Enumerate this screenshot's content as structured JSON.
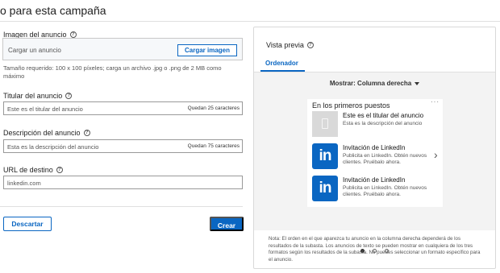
{
  "header": {
    "title": "o para esta campaña"
  },
  "form": {
    "image": {
      "label": "Imagen del anuncio",
      "placeholder": "Cargar un anuncio",
      "upload_button": "Cargar imagen",
      "help": "Tamaño requerido: 100 x 100 píxeles; carga un archivo .jpg o .png de 2 MB como máximo"
    },
    "headline": {
      "label": "Titular del anuncio",
      "placeholder": "Este es el titular del anuncio",
      "counter": "Quedan 25 caracteres"
    },
    "description": {
      "label": "Descripción del anuncio",
      "placeholder": "Esta es la descripción del anuncio",
      "counter": "Quedan 75 caracteres"
    },
    "url": {
      "label": "URL de destino",
      "placeholder": "linkedin.com"
    },
    "cancel_button": "Descartar",
    "create_button": "Crear"
  },
  "preview": {
    "title": "Vista previa",
    "tab": "Ordenador",
    "show_label": "Mostrar: Columna derecha",
    "card_title": "En los primeros puestos",
    "card_menu": "···",
    "ads": [
      {
        "title": "Este es el titular del anuncio",
        "desc": "Esta es la descripción del anuncio",
        "thumb": "placeholder-image-icon"
      },
      {
        "title": "Invitación de LinkedIn",
        "desc": "Publicita en LinkedIn. Obtén nuevos clientes. Pruébalo ahora.",
        "thumb": "linkedin-icon",
        "logo": "in"
      },
      {
        "title": "Invitación de LinkedIn",
        "desc": "Publicita en LinkedIn. Obtén nuevos clientes. Pruébalo ahora.",
        "thumb": "linkedin-icon",
        "logo": "in"
      }
    ],
    "carousel_pages": 3,
    "carousel_active": 1,
    "note": "Nota: El orden en el que aparezca tu anuncio en la columna derecha dependerá de los resultados de la subasta. Los anuncios de texto se pueden mostrar en cualquiera de los tres formatos según los resultados de la subasta. No puedes seleccionar un formato específico para el anuncio."
  },
  "colors": {
    "accent": "#0a66c2",
    "panel_bg": "#f3f3f3"
  }
}
